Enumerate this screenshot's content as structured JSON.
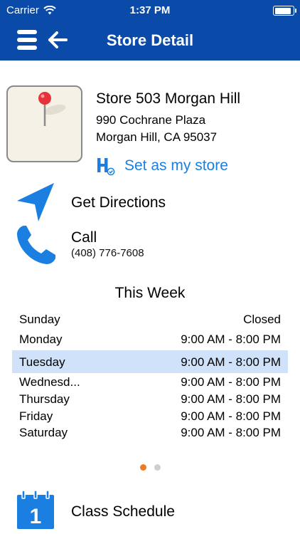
{
  "status_bar": {
    "carrier": "Carrier",
    "time": "1:37 PM"
  },
  "nav": {
    "title": "Store Detail"
  },
  "store": {
    "name": "Store 503 Morgan Hill",
    "address_line1": "990 Cochrane Plaza",
    "address_line2": "Morgan Hill, CA 95037",
    "set_store_label": "Set as my store"
  },
  "actions": {
    "directions_label": "Get Directions",
    "call_label": "Call",
    "phone": "(408) 776-7608",
    "class_schedule_label": "Class Schedule",
    "calendar_day": "1"
  },
  "hours": {
    "title": "This Week",
    "rows": [
      {
        "day": "Sunday",
        "time": "Closed"
      },
      {
        "day": "Monday",
        "time": "9:00 AM - 8:00 PM"
      },
      {
        "day": "Tuesday",
        "time": "9:00 AM - 8:00 PM"
      },
      {
        "day": "Wednesd...",
        "time": "9:00 AM - 8:00 PM"
      },
      {
        "day": "Thursday",
        "time": "9:00 AM - 8:00 PM"
      },
      {
        "day": "Friday",
        "time": "9:00 AM - 8:00 PM"
      },
      {
        "day": "Saturday",
        "time": "9:00 AM - 8:00 PM"
      }
    ],
    "highlighted_day": "Tuesday"
  },
  "pager": {
    "page_count": 2,
    "active_page": 1
  },
  "colors": {
    "header_bg": "#0a4aa8",
    "accent_blue": "#1a7fe0",
    "highlight_row": "#cfe2f9",
    "pager_active": "#f07a22",
    "pager_inactive": "#cfcfcf"
  },
  "icons": {
    "menu": "hamburger-icon",
    "back": "arrow-left-icon",
    "directions": "navigation-arrow-icon",
    "call": "phone-icon",
    "calendar": "calendar-icon",
    "store_brand": "store-h-badge-icon",
    "map_pin": "map-pin-icon"
  }
}
